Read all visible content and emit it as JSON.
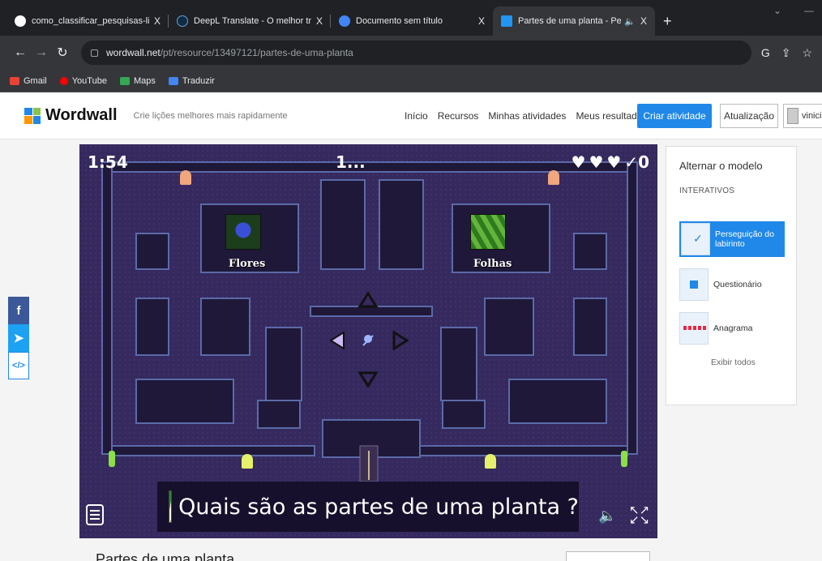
{
  "browser": {
    "tabs": [
      {
        "title": "como_classificar_pesquisas-libre",
        "close": "X",
        "favicon_color": "#ffffff"
      },
      {
        "title": "DeepL Translate - O melhor tradu",
        "close": "X",
        "favicon_color": "#0f2b46"
      },
      {
        "title": "Documento sem título",
        "close": "X",
        "favicon_color": "#4285f4"
      },
      {
        "title": "Partes de uma planta - Perse",
        "close": "X",
        "favicon_color": "#2196f3"
      }
    ],
    "new_tab": "+",
    "url_host": "wordwall.net",
    "url_path": "/pt/resource/13497121/partes-de-uma-planta",
    "bookmarks": [
      {
        "label": "Gmail",
        "color": "#ea4335"
      },
      {
        "label": "YouTube",
        "color": "#ff0000"
      },
      {
        "label": "Maps",
        "color": "#34a853"
      },
      {
        "label": "Traduzir",
        "color": "#4285f4"
      }
    ]
  },
  "header": {
    "logo": "Wordwall",
    "tagline": "Crie lições melhores mais rapidamente",
    "nav": [
      "Início",
      "Recursos",
      "Minhas atividades",
      "Meus resultados"
    ],
    "create_button": "Criar atividade",
    "update_button": "Atualização",
    "user": "vinici"
  },
  "social": {
    "facebook": "f",
    "twitter": "🐦",
    "embed": "</>"
  },
  "game": {
    "timer": "1:54",
    "question_number": "1...",
    "lives": 3,
    "score": "✓0",
    "answers": [
      {
        "label": "Flores"
      },
      {
        "label": "Folhas"
      }
    ],
    "question": "Quais são as partes de uma planta ?"
  },
  "side_panel": {
    "title": "Alternar o modelo",
    "section": "INTERATIVOS",
    "templates": [
      {
        "label": "Perseguição do labirinto",
        "active": true
      },
      {
        "label": "Questionário",
        "active": false
      },
      {
        "label": "Anagrama",
        "active": false
      }
    ],
    "show_all": "Exibir todos"
  },
  "below": {
    "title": "Partes de uma planta"
  },
  "colors": {
    "accent": "#1f88e8",
    "game_bg": "#2c2250"
  }
}
